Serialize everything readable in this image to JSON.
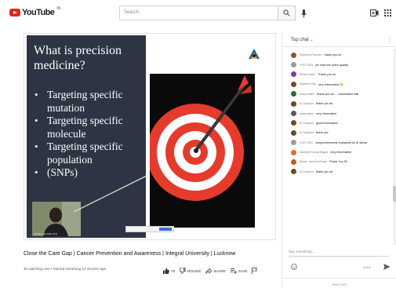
{
  "header": {
    "logo_text": "YouTube",
    "logo_sup": "IN",
    "search_placeholder": "Search",
    "icons": [
      "search-icon",
      "mic-icon",
      "create-video-icon",
      "apps-grid-icon"
    ]
  },
  "slide": {
    "title": "What is precision medicine?",
    "bullets": [
      "Targeting specific mutation",
      "Targeting specific molecule",
      "Targeting specific population",
      "(SNPs)"
    ],
    "cam_caption": "Mohammad Aatar Anis",
    "colors": {
      "slide_bg": "#2d3544",
      "target_red": "#e53b2c",
      "target_white": "#ffffff"
    }
  },
  "video": {
    "title": "Close the Care Gap | Cancer Prevention and Awareness | Integral University | Lucknow",
    "meta": "40 watching now • Started streaming 14 minutes ago",
    "actions": {
      "like_count": "76",
      "dislike_label": "DISLIKE",
      "share_label": "SHARE",
      "save_label": "SAVE"
    }
  },
  "chat": {
    "header": "Top chat",
    "messages": [
      {
        "author": "Muneera Parveen",
        "text": "thank you sir",
        "color": "#8d5a2b"
      },
      {
        "author": "YOO HOO",
        "text": "plz improve video quality",
        "color": "#9e9e9e"
      },
      {
        "author": "Mehfer bano",
        "text": "Thank you sir",
        "color": "#7b3fa0"
      },
      {
        "author": "Sayeed Hina",
        "text": "very informative 👏",
        "color": "#7a4a2a"
      },
      {
        "author": "saba shaikh",
        "text": "thank you sir,.....informative talk",
        "color": "#2d6b3a"
      },
      {
        "author": "IU Campus",
        "text": "thank you sir",
        "color": "#6b4c1f"
      },
      {
        "author": "zama alam",
        "text": "very informative",
        "color": "#5a5a5a"
      },
      {
        "author": "IU Campus",
        "text": "good information",
        "color": "#6b4c1f"
      },
      {
        "author": "IU Campus",
        "text": "thank you",
        "color": "#6b4c1f"
      },
      {
        "author": "YOO HOO",
        "text": "comprehensively explained by dr azhar",
        "color": "#9e9e9e"
      },
      {
        "author": "Saurabh Kumar Bajpai",
        "text": "very informative",
        "color": "#d9722a"
      },
      {
        "author": "Mohd. Javed Ali Khan",
        "text": "Thank You Sir",
        "color": "#c2581f"
      },
      {
        "author": "IU Campus",
        "text": "thank you sir",
        "color": "#6b4c1f"
      }
    ],
    "input_placeholder": "Say something...",
    "counter": "0/200",
    "hide_label": "HIDE CHAT"
  }
}
